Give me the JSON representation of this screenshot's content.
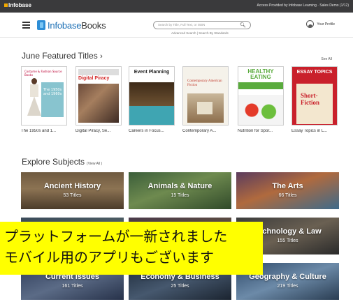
{
  "topbar": {
    "brand": "Infobase",
    "access_text": "Access Provided by Infobase Learning · Sales Demo (1/12)"
  },
  "header": {
    "logo_text_a": "Infobase",
    "logo_text_b": "Books",
    "search_placeholder": "Search by Title, Full Text, or ISBN",
    "search_sub": "Advanced Search | Search By Standards",
    "profile_label": "Your Profile"
  },
  "featured": {
    "title": "June Featured Titles",
    "chevron": "›",
    "see_all": "See All",
    "books": [
      {
        "title": "The 1950s and 1...",
        "cover_header": "Costume & Fashion Source Books",
        "cover_sub": "The 1950s and 1960s"
      },
      {
        "title": "Digital Piracy, Se...",
        "cover_header": "DIGITAL PIRACY",
        "cover_sub": "Digital Piracy"
      },
      {
        "title": "Careers in Focus...",
        "cover_header": "Event Planning",
        "cover_sub": ""
      },
      {
        "title": "Contemporary A...",
        "cover_header": "Contemporary American Fiction",
        "cover_sub": ""
      },
      {
        "title": "Nutrition for Spor...",
        "cover_header": "HEALTHY EATING",
        "cover_sub": ""
      },
      {
        "title": "Essay Topics in L...",
        "cover_header": "ESSAY TOPICS",
        "cover_sub": "Short-Fiction"
      }
    ]
  },
  "explore": {
    "title": "Explore Subjects",
    "view_all": "(View All )",
    "tiles": [
      {
        "name": "Ancient History",
        "count": "53 Titles"
      },
      {
        "name": "Animals & Nature",
        "count": "15 Titles"
      },
      {
        "name": "The Arts",
        "count": "66 Titles"
      },
      {
        "name": "Technology & Law",
        "count": "155 Titles"
      },
      {
        "name": "Current Issues",
        "count": "161 Titles"
      },
      {
        "name": "Economy & Business",
        "count": "25 Titles"
      },
      {
        "name": "Geography & Culture",
        "count": "219 Titles"
      }
    ]
  },
  "banner": {
    "line1": "プラットフォームが一新されました",
    "line2": "モバイル用のアプリもございます"
  },
  "colors": {
    "topbar_bg": "#3a3a3c",
    "brand_blue": "#1c6fb5",
    "banner_yellow": "#ffff00"
  }
}
